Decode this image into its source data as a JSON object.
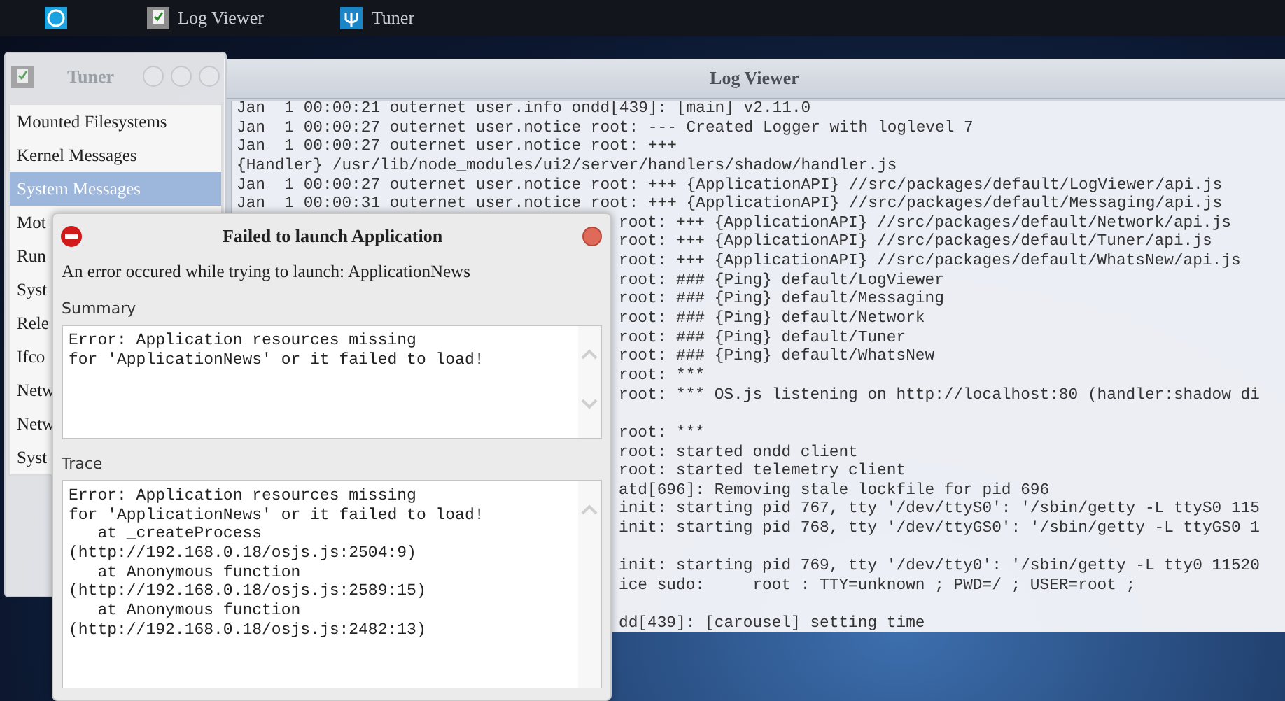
{
  "taskbar": {
    "items": [
      {
        "kind": "launcher"
      },
      {
        "kind": "logviewer",
        "label": "Log Viewer"
      },
      {
        "kind": "tuner",
        "label": "Tuner"
      }
    ]
  },
  "tuner_window": {
    "title": "Tuner"
  },
  "log_viewer": {
    "title": "Log Viewer",
    "sources": [
      {
        "label": "Mounted Filesystems",
        "selected": false
      },
      {
        "label": "Kernel Messages",
        "selected": false
      },
      {
        "label": "System Messages",
        "selected": true
      },
      {
        "label": "Mot",
        "selected": false
      },
      {
        "label": "Run",
        "selected": false
      },
      {
        "label": "Syst",
        "selected": false
      },
      {
        "label": "Rele",
        "selected": false
      },
      {
        "label": "Ifco",
        "selected": false
      },
      {
        "label": "Netw",
        "selected": false
      },
      {
        "label": "Netw",
        "selected": false
      },
      {
        "label": "Syst",
        "selected": false
      }
    ],
    "lines": [
      {
        "text": "Jan  1 00:00:21 outernet user.info ondd[439]: [main] v2.11.0"
      },
      {
        "text": "Jan  1 00:00:27 outernet user.notice root: --- Created Logger with loglevel 7"
      },
      {
        "text": "Jan  1 00:00:27 outernet user.notice root: +++"
      },
      {
        "text": "{Handler} /usr/lib/node_modules/ui2/server/handlers/shadow/handler.js"
      },
      {
        "text": "Jan  1 00:00:27 outernet user.notice root: +++ {ApplicationAPI} //src/packages/default/LogViewer/api.js"
      },
      {
        "text": "Jan  1 00:00:31 outernet user.notice root: +++ {ApplicationAPI} //src/packages/default/Messaging/api.js"
      }
    ],
    "lines_beside_dialog": [
      {
        "kind": "text",
        "text": "root: +++ {ApplicationAPI} //src/packages/default/Network/api.js"
      },
      {
        "kind": "text",
        "text": "root: +++ {ApplicationAPI} //src/packages/default/Tuner/api.js"
      },
      {
        "kind": "text",
        "text": "root: +++ {ApplicationAPI} //src/packages/default/WhatsNew/api.js"
      },
      {
        "kind": "text",
        "text": "root: ### {Ping} default/LogViewer"
      },
      {
        "kind": "text",
        "text": "root: ### {Ping} default/Messaging"
      },
      {
        "kind": "text",
        "text": "root: ### {Ping} default/Network"
      },
      {
        "kind": "text",
        "text": "root: ### {Ping} default/Tuner"
      },
      {
        "kind": "text",
        "text": "root: ### {Ping} default/WhatsNew"
      },
      {
        "kind": "text",
        "text": "root: ***"
      },
      {
        "kind": "text",
        "text": "root: *** OS.js listening on http://localhost:80 (handler:shadow di"
      },
      {
        "kind": "blank"
      },
      {
        "kind": "text",
        "text": "root: ***"
      },
      {
        "kind": "text",
        "text": "root: started ondd client"
      },
      {
        "kind": "text",
        "text": "root: started telemetry client"
      },
      {
        "kind": "text",
        "text": "atd[696]: Removing stale lockfile for pid 696"
      },
      {
        "kind": "text",
        "text": "init: starting pid 767, tty '/dev/ttyS0': '/sbin/getty -L ttyS0 115"
      },
      {
        "kind": "text",
        "text": "init: starting pid 768, tty '/dev/ttyGS0': '/sbin/getty -L ttyGS0 1"
      },
      {
        "kind": "blank"
      },
      {
        "kind": "text",
        "text": "init: starting pid 769, tty '/dev/tty0': '/sbin/getty -L tty0 11520"
      },
      {
        "kind": "text",
        "text": "ice sudo:     root : TTY=unknown ; PWD=/ ; USER=root ;"
      },
      {
        "kind": "blank"
      },
      {
        "kind": "text",
        "text": "dd[439]: [carousel] setting time"
      }
    ]
  },
  "dialog": {
    "title": "Failed to launch Application",
    "message": "An error occured while trying to launch: ApplicationNews",
    "summary": {
      "label": "Summary",
      "value": "Error: Application resources missing\nfor 'ApplicationNews' or it failed to load!"
    },
    "trace": {
      "label": "Trace",
      "value": "Error: Application resources missing\nfor 'ApplicationNews' or it failed to load!\n   at _createProcess\n(http://192.168.0.18/osjs.js:2504:9)\n   at Anonymous function\n(http://192.168.0.18/osjs.js:2589:15)\n   at Anonymous function\n(http://192.168.0.18/osjs.js:2482:13)"
    }
  }
}
